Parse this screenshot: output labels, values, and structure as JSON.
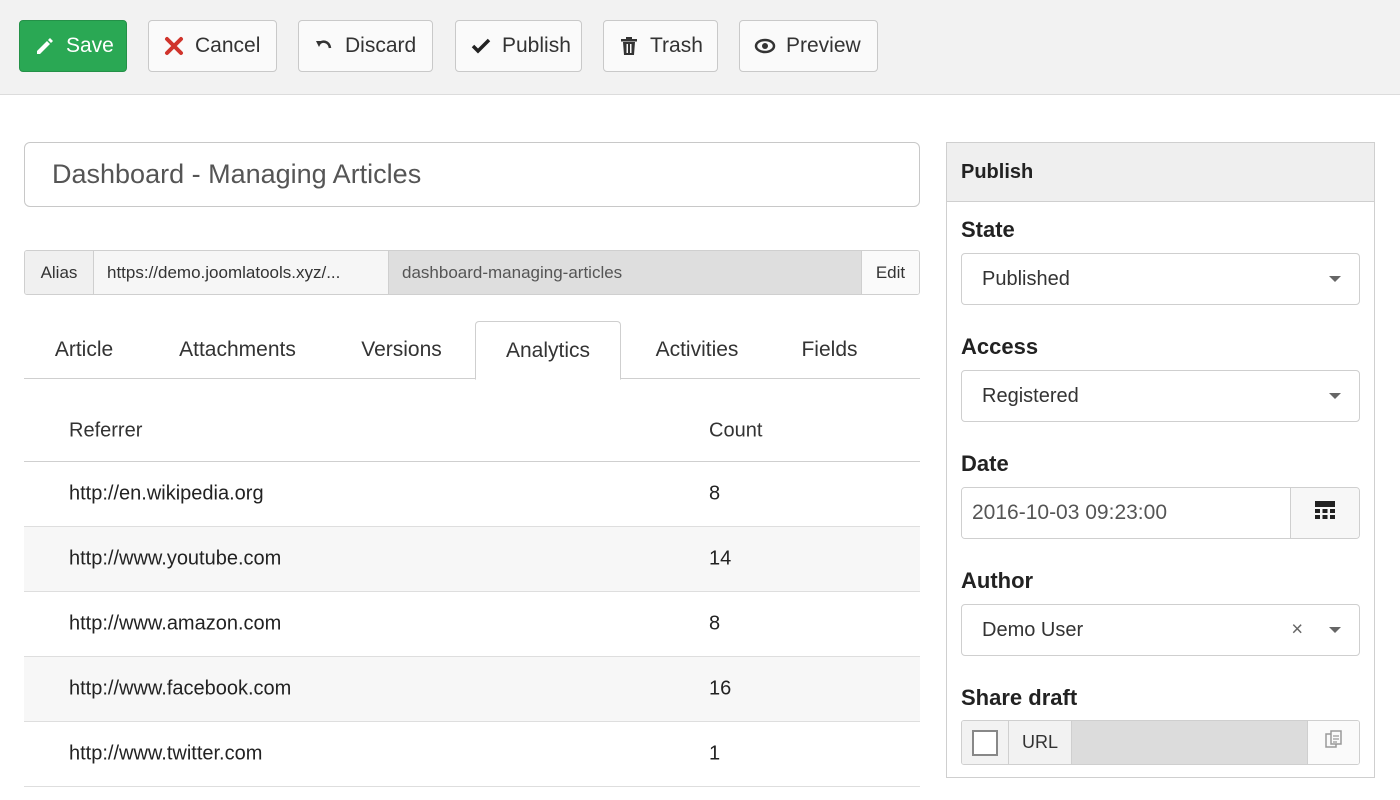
{
  "toolbar": {
    "buttons": [
      {
        "label": "Save",
        "icon": "pencil-icon"
      },
      {
        "label": "Cancel",
        "icon": "close-icon"
      },
      {
        "label": "Discard",
        "icon": "undo-icon"
      },
      {
        "label": "Publish",
        "icon": "check-icon"
      },
      {
        "label": "Trash",
        "icon": "trash-icon"
      },
      {
        "label": "Preview",
        "icon": "eye-icon"
      }
    ],
    "save_color": "#2aa854",
    "cancel_icon_color": "#d0342c"
  },
  "article": {
    "title": "Dashboard - Managing Articles",
    "alias": {
      "label": "Alias",
      "base_url": "https://demo.joomlatools.xyz/...",
      "slug": "dashboard-managing-articles",
      "edit_label": "Edit"
    }
  },
  "tabs": [
    {
      "label": "Article",
      "active": false
    },
    {
      "label": "Attachments",
      "active": false
    },
    {
      "label": "Versions",
      "active": false
    },
    {
      "label": "Analytics",
      "active": true
    },
    {
      "label": "Activities",
      "active": false
    },
    {
      "label": "Fields",
      "active": false
    }
  ],
  "analytics": {
    "columns": {
      "referrer": "Referrer",
      "count": "Count"
    },
    "rows": [
      {
        "referrer": "http://en.wikipedia.org",
        "count": "8"
      },
      {
        "referrer": "http://www.youtube.com",
        "count": "14"
      },
      {
        "referrer": "http://www.amazon.com",
        "count": "8"
      },
      {
        "referrer": "http://www.facebook.com",
        "count": "16"
      },
      {
        "referrer": "http://www.twitter.com",
        "count": "1"
      }
    ]
  },
  "publish_panel": {
    "title": "Publish",
    "state": {
      "label": "State",
      "value": "Published"
    },
    "access": {
      "label": "Access",
      "value": "Registered"
    },
    "date": {
      "label": "Date",
      "value": "2016-10-03 09:23:00",
      "icon": "calendar-icon"
    },
    "author": {
      "label": "Author",
      "value": "Demo User",
      "clear_symbol": "×"
    },
    "share_draft": {
      "label": "Share draft",
      "url_label": "URL",
      "checked": false,
      "icon": "copy-icon"
    }
  }
}
